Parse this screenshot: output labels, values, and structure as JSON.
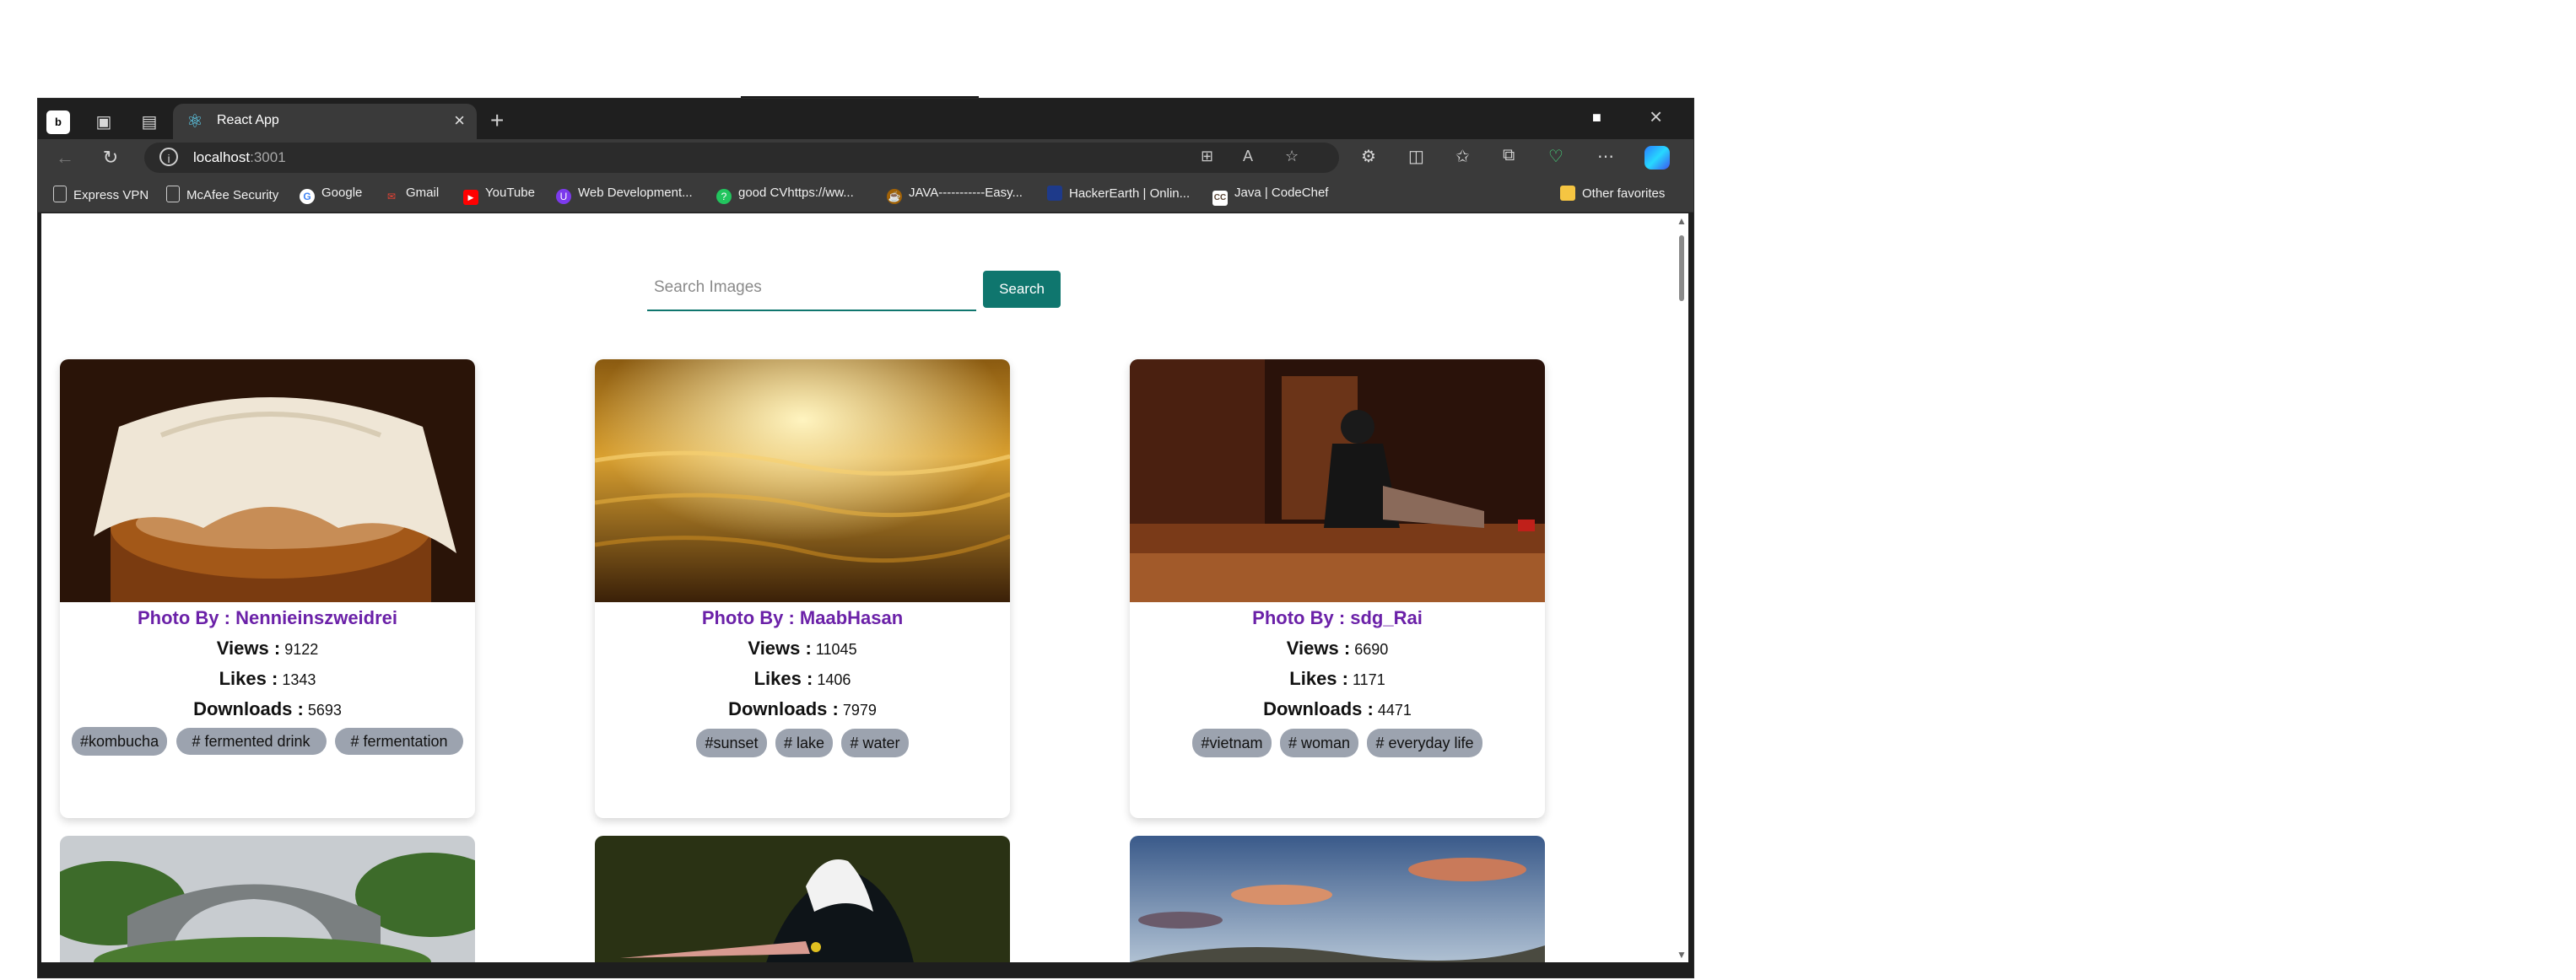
{
  "browser": {
    "tab_title": "React App",
    "url_host": "localhost",
    "url_port": ":3001",
    "favorites": [
      {
        "label": "Express VPN",
        "icon": "page-icon"
      },
      {
        "label": "McAfee Security",
        "icon": "page-icon"
      },
      {
        "label": "Google",
        "icon": "google-icon"
      },
      {
        "label": "Gmail",
        "icon": "gmail-icon"
      },
      {
        "label": "YouTube",
        "icon": "youtube-icon"
      },
      {
        "label": "Web Development...",
        "icon": "web-icon"
      },
      {
        "label": "good CVhttps://ww...",
        "icon": "cv-icon"
      },
      {
        "label": "JAVA-----------Easy...",
        "icon": "java-icon"
      },
      {
        "label": "HackerEarth | Onlin...",
        "icon": "hackerearth-icon"
      },
      {
        "label": "Java | CodeChef",
        "icon": "codechef-icon"
      }
    ],
    "other_favorites": "Other favorites"
  },
  "search": {
    "placeholder": "Search Images",
    "button_label": "Search"
  },
  "labels": {
    "views": "Views :",
    "likes": "Likes :",
    "downloads": "Downloads :"
  },
  "cards": [
    {
      "author": "Photo By : Nennieinszweidrei",
      "views": "9122",
      "likes": "1343",
      "downloads": "5693",
      "tags": [
        "#kombucha",
        "# fermented drink",
        "# fermentation"
      ]
    },
    {
      "author": "Photo By : MaabHasan",
      "views": "11045",
      "likes": "1406",
      "downloads": "7979",
      "tags": [
        "#sunset",
        "# lake",
        "# water"
      ]
    },
    {
      "author": "Photo By : sdg_Rai",
      "views": "6690",
      "likes": "1171",
      "downloads": "4471",
      "tags": [
        "#vietnam",
        "# woman",
        "# everyday life"
      ]
    }
  ],
  "colors": {
    "accent": "#0f766e",
    "author": "#6b21a8",
    "tag_bg": "#9ca3af"
  }
}
